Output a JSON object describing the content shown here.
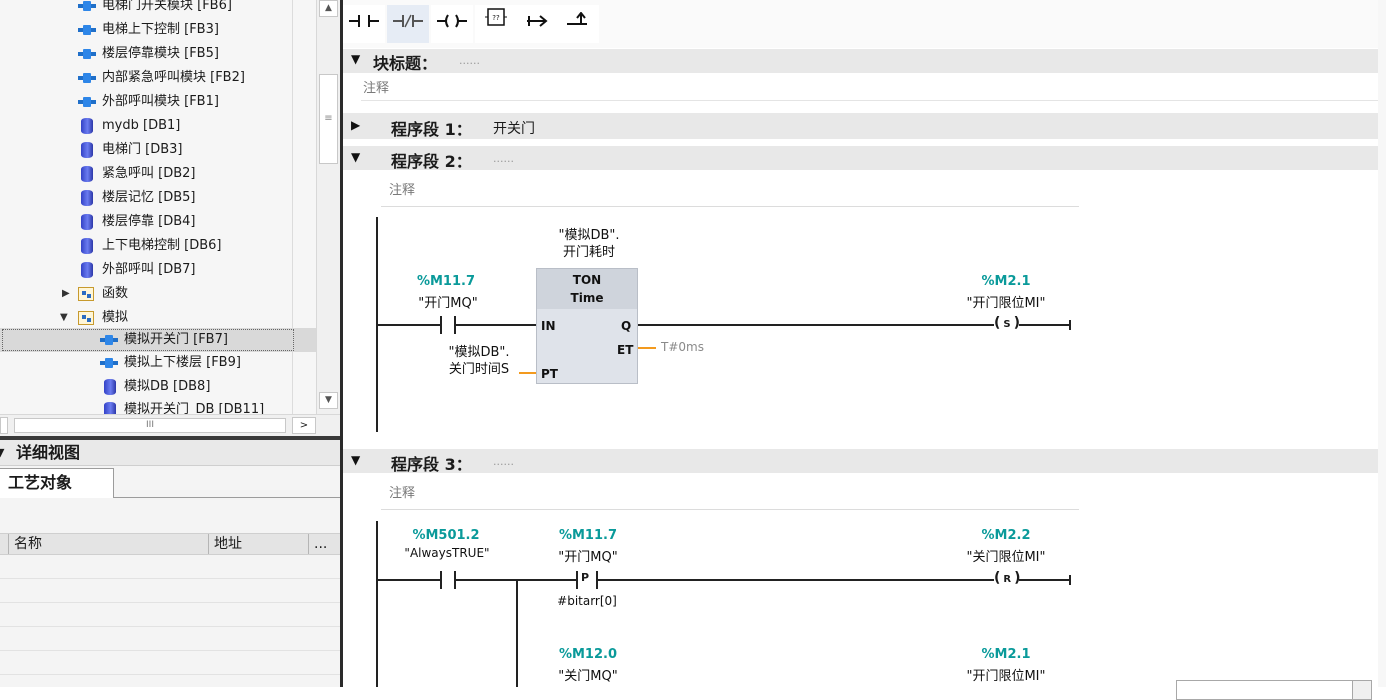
{
  "project_tree": {
    "items": [
      {
        "label": "电梯门开关模块 [FB6]",
        "icon": "fb-icon"
      },
      {
        "label": "电梯上下控制 [FB3]",
        "icon": "fb-icon"
      },
      {
        "label": "楼层停靠模块 [FB5]",
        "icon": "fb-icon"
      },
      {
        "label": "内部紧急呼叫模块 [FB2]",
        "icon": "fb-icon"
      },
      {
        "label": "外部呼叫模块 [FB1]",
        "icon": "fb-icon"
      },
      {
        "label": "mydb [DB1]",
        "icon": "db-icon"
      },
      {
        "label": "电梯门 [DB3]",
        "icon": "db-icon"
      },
      {
        "label": "紧急呼叫 [DB2]",
        "icon": "db-icon"
      },
      {
        "label": "楼层记忆 [DB5]",
        "icon": "db-icon"
      },
      {
        "label": "楼层停靠 [DB4]",
        "icon": "db-icon"
      },
      {
        "label": "上下电梯控制 [DB6]",
        "icon": "db-icon"
      },
      {
        "label": "外部呼叫 [DB7]",
        "icon": "db-icon"
      },
      {
        "label": "函数",
        "icon": "folder-icon"
      },
      {
        "label": "模拟",
        "icon": "folder-icon"
      },
      {
        "label": "模拟开关门 [FB7]",
        "icon": "fb-icon"
      },
      {
        "label": "模拟上下楼层 [FB9]",
        "icon": "fb-icon"
      },
      {
        "label": "模拟DB [DB8]",
        "icon": "db-icon"
      },
      {
        "label": "模拟开关门_DB [DB11]",
        "icon": "db-icon"
      }
    ],
    "hscroll_grip": "III"
  },
  "detail_view": {
    "title": "详细视图",
    "tab": "工艺对象",
    "col_name": "名称",
    "col_address": "地址",
    "col_more": "..."
  },
  "editor": {
    "block_title_label": "块标题：",
    "block_comment": "注释",
    "dots": "......",
    "networks": [
      {
        "label": "程序段 1：",
        "title": "开关门"
      },
      {
        "label": "程序段 2：",
        "comment": "注释"
      },
      {
        "label": "程序段 3：",
        "comment": "注释"
      }
    ],
    "net2": {
      "contact_addr": "%M11.7",
      "contact_tag": "\"开门MQ\"",
      "timer_instance_line1": "\"模拟DB\".",
      "timer_instance_line2": "开门耗时",
      "timer_type": "TON",
      "timer_subtype": "Time",
      "pin_in": "IN",
      "pin_q": "Q",
      "pin_et": "ET",
      "pin_pt": "PT",
      "pt_line1": "\"模拟DB\".",
      "pt_line2": "关门时间S",
      "et_value": "T#0ms",
      "coil_addr": "%M2.1",
      "coil_tag": "\"开门限位MI\"",
      "coil_type": "S"
    },
    "net3": {
      "c1_addr": "%M501.2",
      "c1_tag": "\"AlwaysTRUE\"",
      "c2_addr": "%M11.7",
      "c2_tag": "\"开门MQ\"",
      "c2_type": "P",
      "c2_bit": "#bitarr[0]",
      "coil_addr": "%M2.2",
      "coil_tag": "\"关门限位MI\"",
      "coil_type": "R",
      "c3_addr": "%M12.0",
      "c3_tag": "\"关门MQ\"",
      "coil2_addr": "%M2.1",
      "coil2_tag": "\"开门限位MI\""
    }
  },
  "colors": {
    "address": "#0a9a9a",
    "timer_box": "#dfe3ea",
    "pin_wire": "#f39a1e"
  }
}
